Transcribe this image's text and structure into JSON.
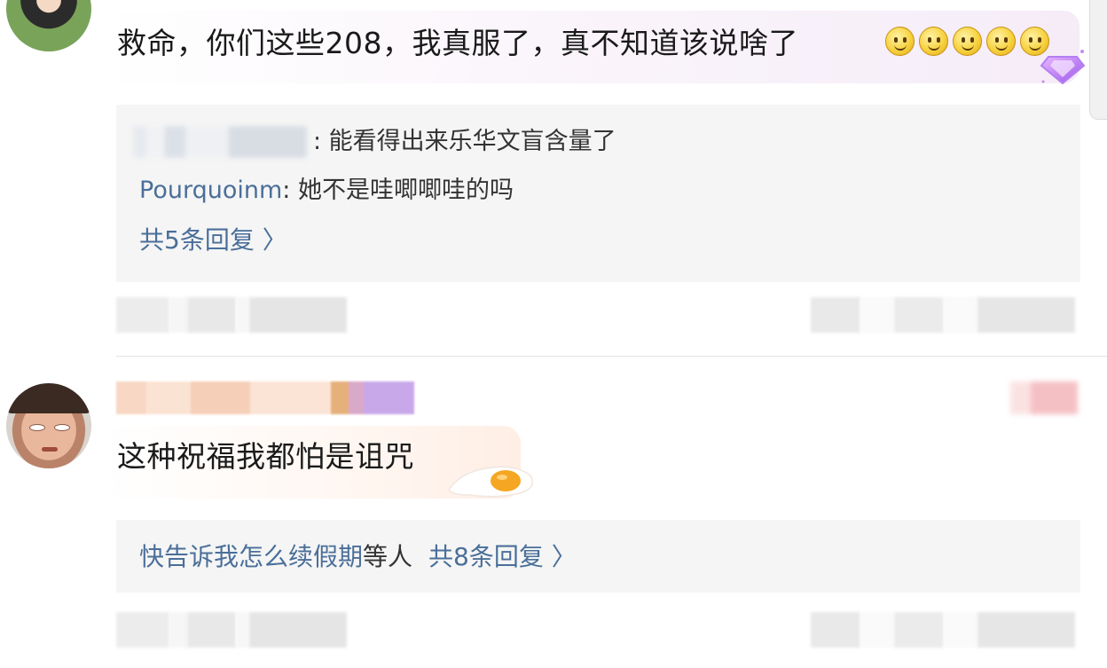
{
  "comment1": {
    "text": "救命，你们这些208，我真服了，真不知道该说啥了",
    "emoji": [
      "smile-emoji",
      "smile-emoji",
      "smile-emoji",
      "smile-emoji",
      "smile-emoji"
    ],
    "replies": [
      {
        "username": "",
        "text": ": 能看得出来乐华文盲含量了"
      },
      {
        "username": "Pourquoinm",
        "text": ": 她不是哇唧唧哇的吗"
      }
    ],
    "more_replies": "共5条回复 〉"
  },
  "comment2": {
    "text": "这种祝福我都怕是诅咒",
    "reply_user": "快告诉我怎么续假期",
    "reply_text": "等人",
    "more_replies": "共8条回复 〉"
  },
  "colors": {
    "link": "#4a6f99",
    "reply_bg": "#f5f5f5",
    "divider": "#e2e2e2"
  }
}
